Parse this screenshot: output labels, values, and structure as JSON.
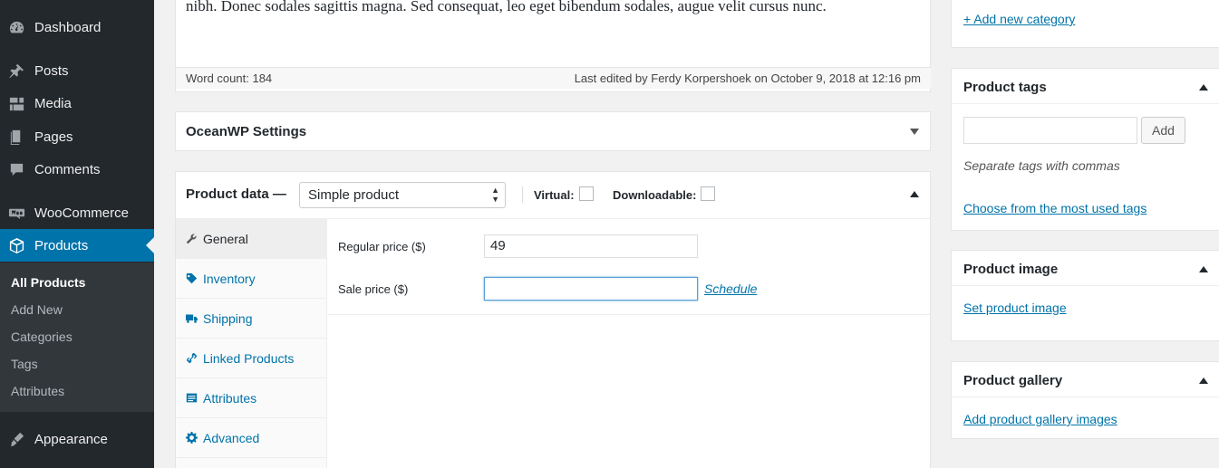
{
  "sidebar": {
    "menu": [
      {
        "label": "Dashboard",
        "icon": "dashboard-icon"
      },
      {
        "label": "Posts",
        "icon": "pin-icon"
      },
      {
        "label": "Media",
        "icon": "media-icon"
      },
      {
        "label": "Pages",
        "icon": "pages-icon"
      },
      {
        "label": "Comments",
        "icon": "comments-icon"
      },
      {
        "label": "WooCommerce",
        "icon": "woocommerce-icon"
      },
      {
        "label": "Products",
        "icon": "box-icon",
        "active": true
      },
      {
        "label": "Appearance",
        "icon": "brush-icon"
      }
    ],
    "submenu": [
      "All Products",
      "Add New",
      "Categories",
      "Tags",
      "Attributes"
    ],
    "current_submenu": "All Products"
  },
  "editor": {
    "text": "nibh. Donec sodales sagittis magna. Sed consequat, leo eget bibendum sodales, augue velit cursus nunc.",
    "word_count": "Word count: 184",
    "last_edited": "Last edited by Ferdy Korpershoek on October 9, 2018 at 12:16 pm"
  },
  "oceanwp": {
    "title": "OceanWP Settings"
  },
  "product_data": {
    "title": "Product data —",
    "type_select": "Simple product",
    "virtual_label": "Virtual:",
    "downloadable_label": "Downloadable:",
    "tabs": [
      {
        "label": "General",
        "icon": "wrench-icon"
      },
      {
        "label": "Inventory",
        "icon": "tag-icon"
      },
      {
        "label": "Shipping",
        "icon": "truck-icon"
      },
      {
        "label": "Linked Products",
        "icon": "link-icon"
      },
      {
        "label": "Attributes",
        "icon": "list-icon"
      },
      {
        "label": "Advanced",
        "icon": "gear-icon"
      }
    ],
    "regular_price_label": "Regular price ($)",
    "regular_price_value": "49",
    "sale_price_label": "Sale price ($)",
    "sale_price_value": "",
    "schedule_link": "Schedule"
  },
  "categories": {
    "add_new_link": "+ Add new category"
  },
  "product_tags": {
    "title": "Product tags",
    "input_value": "",
    "add_button": "Add",
    "hint": "Separate tags with commas",
    "choose_link": "Choose from the most used tags"
  },
  "product_image": {
    "title": "Product image",
    "set_link": "Set product image"
  },
  "product_gallery": {
    "title": "Product gallery",
    "add_link": "Add product gallery images"
  },
  "colors": {
    "accent": "#0073aa",
    "sidebar_bg": "#23282d",
    "submenu_bg": "#32373c"
  }
}
